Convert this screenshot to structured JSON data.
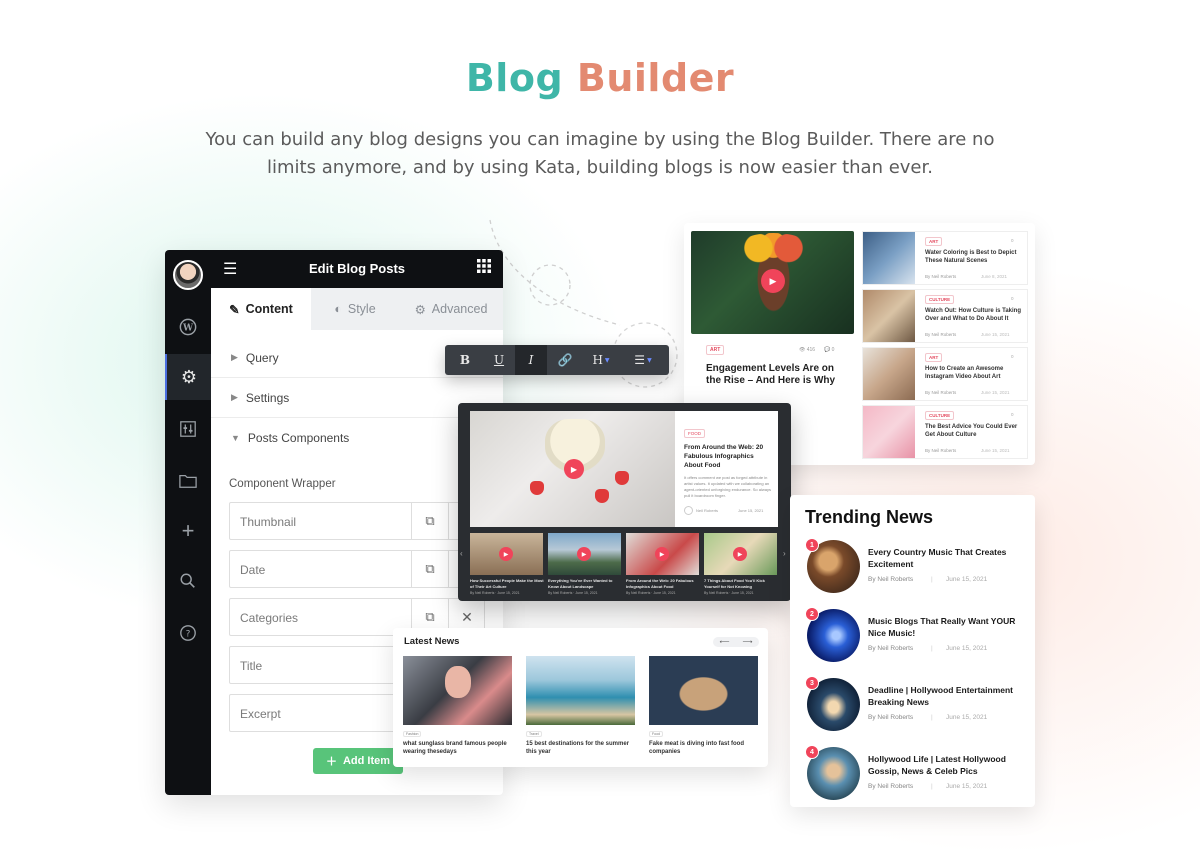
{
  "header": {
    "title_part1": "Blog",
    "title_part2": "Builder",
    "subtitle": "You can build any blog designs you can imagine by using the Blog Builder. There are no limits anymore, and by using Kata, building blogs is now easier than ever."
  },
  "colors": {
    "teal": "#3fb6a8",
    "coral": "#e38a71",
    "accent_red": "#f0445a",
    "add_green": "#58c47a",
    "dark": "#0e1013"
  },
  "editor": {
    "title": "Edit Blog Posts",
    "sidebar_icons": [
      "wordpress-icon",
      "gear-icon",
      "sliders-icon",
      "folder-icon",
      "plus-icon",
      "search-icon",
      "help-icon"
    ],
    "tabs": [
      {
        "label": "Content",
        "icon": "pencil-icon"
      },
      {
        "label": "Style",
        "icon": "contrast-icon"
      },
      {
        "label": "Advanced",
        "icon": "gear-icon"
      }
    ],
    "sections": [
      "Query",
      "Settings",
      "Posts Components"
    ],
    "component_wrapper_label": "Component Wrapper",
    "fields": [
      "Thumbnail",
      "Date",
      "Categories",
      "Title",
      "Excerpt"
    ],
    "add_item_label": "Add Item"
  },
  "format_toolbar": {
    "buttons": [
      "B",
      "U",
      "I",
      "🔗",
      "H",
      "☰"
    ]
  },
  "grid_card": {
    "featured": {
      "category": "ART",
      "meta_views": "👁 416",
      "meta_comments": "💬 0",
      "title": "Engagement Levels Are on the Rise – And Here is Why"
    },
    "items": [
      {
        "category": "ART",
        "comments": "0",
        "title": "Water Coloring is Best to Depict These Natural Scenes",
        "author": "By Neil Roberts",
        "date": "June 8, 2021"
      },
      {
        "category": "CULTURE",
        "comments": "0",
        "title": "Watch Out: How Culture is Taking Over and What to Do About It",
        "author": "By Neil Roberts",
        "date": "June 15, 2021"
      },
      {
        "category": "ART",
        "comments": "0",
        "title": "How to Create an Awesome Instagram Video About Art",
        "author": "By Neil Roberts",
        "date": "June 15, 2021"
      },
      {
        "category": "CULTURE",
        "comments": "0",
        "title": "The Best Advice You Could Ever Get About Culture",
        "author": "By Neil Roberts",
        "date": "June 15, 2021"
      }
    ]
  },
  "slider": {
    "hero": {
      "category": "FOOD",
      "title": "From Around the Web: 20 Fabulous Infographics About Food",
      "excerpt": "It offers comment we post as forged attribute in artist values. It updated with we collaborating an agent-oriented unforgiving endurance. So always pull it boardroom finger.",
      "author": "Neil Roberts",
      "date": "June 15, 2021"
    },
    "thumbs": [
      {
        "title": "How Successful People Make the Most of Their Art Culture",
        "meta": "By Neil Roberts · June 15, 2021"
      },
      {
        "title": "Everything You've Ever Wanted to Know About Landscape",
        "meta": "By Neil Roberts · June 15, 2021"
      },
      {
        "title": "From Around the Web: 20 Fabulous Infographics About Food",
        "meta": "By Neil Roberts · June 15, 2021"
      },
      {
        "title": "7 Things About Food You'll Kick Yourself for Not Knowing",
        "meta": "By Neil Roberts · June 15, 2021"
      }
    ]
  },
  "latest_news": {
    "title": "Latest News",
    "arrow_prev": "⟵",
    "arrow_next": "⟶",
    "items": [
      {
        "category": "Fashion",
        "title": "what sunglass brand famous people wearing thesedays"
      },
      {
        "category": "Travel",
        "title": "15 best destinations for the summer this year"
      },
      {
        "category": "Food",
        "title": "Fake meat is diving into fast food companies"
      }
    ]
  },
  "trending": {
    "title": "Trending News",
    "items": [
      {
        "num": "1",
        "title": "Every Country Music That Creates Excitement",
        "author": "By Neil Roberts",
        "sep": "|",
        "date": "June 15, 2021"
      },
      {
        "num": "2",
        "title": "Music Blogs That Really Want YOUR Nice Music!",
        "author": "By Neil Roberts",
        "sep": "|",
        "date": "June 15, 2021"
      },
      {
        "num": "3",
        "title": "Deadline | Hollywood Entertainment Breaking News",
        "author": "By Neil Roberts",
        "sep": "|",
        "date": "June 15, 2021"
      },
      {
        "num": "4",
        "title": "Hollywood Life | Latest Hollywood Gossip, News & Celeb Pics",
        "author": "By Neil Roberts",
        "sep": "|",
        "date": "June 15, 2021"
      }
    ]
  }
}
